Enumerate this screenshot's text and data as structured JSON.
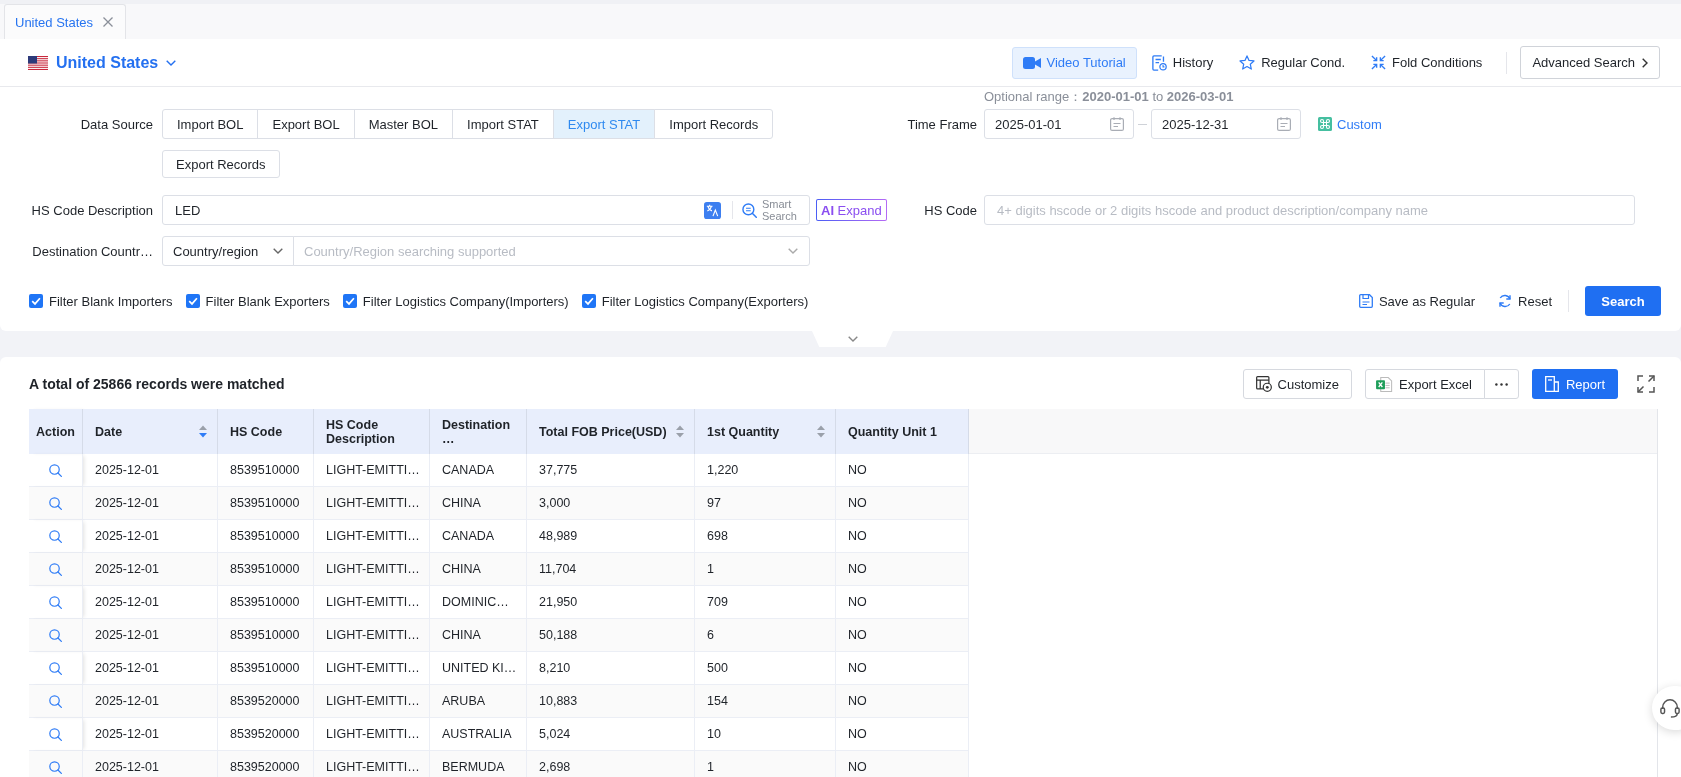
{
  "tabs": [
    {
      "label": "United States",
      "selected": true
    }
  ],
  "header": {
    "country": "United States",
    "tools": [
      {
        "label": "Video Tutorial",
        "highlighted": true
      },
      {
        "label": "History",
        "highlighted": false
      },
      {
        "label": "Regular Cond.",
        "highlighted": false
      },
      {
        "label": "Fold Conditions",
        "highlighted": false
      }
    ],
    "advanced_search": "Advanced Search"
  },
  "filters": {
    "optional_range": "Optional range：**2020-01-01** to **2026-03-01**",
    "data_source": {
      "label": "Data Source",
      "options": [
        {
          "label": "Import BOL",
          "selected": false
        },
        {
          "label": "Export BOL",
          "selected": false
        },
        {
          "label": "Master BOL",
          "selected": false
        },
        {
          "label": "Import STAT",
          "selected": false
        },
        {
          "label": "Export STAT",
          "selected": true
        },
        {
          "label": "Import Records",
          "selected": false
        },
        {
          "label": "Export Records",
          "selected": false
        }
      ]
    },
    "time_frame": {
      "label": "Time Frame",
      "start": "2025-01-01",
      "end": "2025-12-31",
      "custom": "Custom"
    },
    "hs_code_description": {
      "label": "HS Code Description",
      "value": "LED",
      "smart_search": "Smart Search",
      "expand": "**AI** Expand"
    },
    "hs_code": {
      "label": "HS Code",
      "placeholder": "4+ digits hscode or 2 digits hscode and product description/company name"
    },
    "destination": {
      "label": "Destination Countr…",
      "type": "Country/region",
      "placeholder": "Country/Region searching supported"
    },
    "options": [
      {
        "label": "Filter Blank Importers",
        "checked": true
      },
      {
        "label": "Filter Blank Exporters",
        "checked": true
      },
      {
        "label": "Filter Logistics Company(Importers)",
        "checked": true
      },
      {
        "label": "Filter Logistics Company(Exporters)",
        "checked": true
      }
    ],
    "save": "Save as Regular",
    "reset": "Reset",
    "search": "Search"
  },
  "results": {
    "summary": "A total of **25866** records were matched",
    "customize": "Customize",
    "export": "Export Excel",
    "report": "Report",
    "table": {
      "columns": [
        {
          "label": "Action"
        },
        {
          "label": "Date",
          "sorted": true
        },
        {
          "label": "HS Code"
        },
        {
          "label": "HS Code Description"
        },
        {
          "label": "Destination…"
        },
        {
          "label": "Total FOB Price(USD)",
          "sorted": false
        },
        {
          "label": "1st Quantity",
          "sorted": false
        },
        {
          "label": "Quantity Unit 1"
        }
      ],
      "rows": [
        {
          "cells": [
            "",
            "2025-12-01",
            "8539510000",
            "LIGHT-EMITTI…",
            "CANADA",
            "37,775",
            "1,220",
            "NO"
          ]
        },
        {
          "cells": [
            "",
            "2025-12-01",
            "8539510000",
            "LIGHT-EMITTI…",
            "CHINA",
            "3,000",
            "97",
            "NO"
          ]
        },
        {
          "cells": [
            "",
            "2025-12-01",
            "8539510000",
            "LIGHT-EMITTI…",
            "CANADA",
            "48,989",
            "698",
            "NO"
          ]
        },
        {
          "cells": [
            "",
            "2025-12-01",
            "8539510000",
            "LIGHT-EMITTI…",
            "CHINA",
            "11,704",
            "1",
            "NO"
          ]
        },
        {
          "cells": [
            "",
            "2025-12-01",
            "8539510000",
            "LIGHT-EMITTI…",
            "DOMINIC…",
            "21,950",
            "709",
            "NO"
          ]
        },
        {
          "cells": [
            "",
            "2025-12-01",
            "8539510000",
            "LIGHT-EMITTI…",
            "CHINA",
            "50,188",
            "6",
            "NO"
          ]
        },
        {
          "cells": [
            "",
            "2025-12-01",
            "8539510000",
            "LIGHT-EMITTI…",
            "UNITED KI…",
            "8,210",
            "500",
            "NO"
          ]
        },
        {
          "cells": [
            "",
            "2025-12-01",
            "8539520000",
            "LIGHT-EMITTI…",
            "ARUBA",
            "10,883",
            "154",
            "NO"
          ]
        },
        {
          "cells": [
            "",
            "2025-12-01",
            "8539520000",
            "LIGHT-EMITTI…",
            "AUSTRALIA",
            "5,024",
            "10",
            "NO"
          ]
        },
        {
          "cells": [
            "",
            "2025-12-01",
            "8539520000",
            "LIGHT-EMITTI…",
            "BERMUDA",
            "2,698",
            "1",
            "NO"
          ]
        }
      ]
    }
  }
}
